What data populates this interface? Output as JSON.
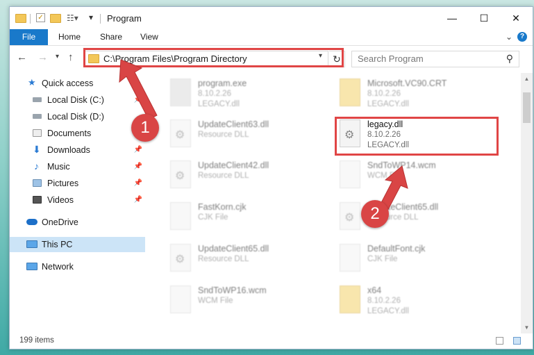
{
  "window": {
    "title": "Program"
  },
  "ribbon": {
    "file": "File",
    "home": "Home",
    "share": "Share",
    "view": "View"
  },
  "nav": {
    "address": "C:\\Program Files\\Program Directory",
    "search_placeholder": "Search Program"
  },
  "sidebar": {
    "items": [
      {
        "label": "Quick access",
        "icon": "star-icon",
        "pinned": false
      },
      {
        "label": "Local Disk (C:)",
        "icon": "drive-icon",
        "pinned": true
      },
      {
        "label": "Local Disk (D:)",
        "icon": "drive-icon",
        "pinned": false
      },
      {
        "label": "Documents",
        "icon": "documents-icon",
        "pinned": true
      },
      {
        "label": "Downloads",
        "icon": "download-icon",
        "pinned": true
      },
      {
        "label": "Music",
        "icon": "music-icon",
        "pinned": true
      },
      {
        "label": "Pictures",
        "icon": "pictures-icon",
        "pinned": true
      },
      {
        "label": "Videos",
        "icon": "videos-icon",
        "pinned": true
      },
      {
        "label": "OneDrive",
        "icon": "cloud-icon",
        "pinned": false
      },
      {
        "label": "This PC",
        "icon": "computer-icon",
        "pinned": false,
        "selected": true
      },
      {
        "label": "Network",
        "icon": "network-icon",
        "pinned": false
      }
    ]
  },
  "files": [
    {
      "name": "program.exe",
      "line2": "8.10.2.26",
      "line3": "LEGACY.dll",
      "icon": "exe"
    },
    {
      "name": "Microsoft.VC90.CRT",
      "line2": "8.10.2.26",
      "line3": "LEGACY.dll",
      "icon": "folder"
    },
    {
      "name": "UpdateClient63.dll",
      "line2": "Resource DLL",
      "line3": "",
      "icon": "gear"
    },
    {
      "name": "legacy.dll",
      "line2": "8.10.2.26",
      "line3": "LEGACY.dll",
      "icon": "gear"
    },
    {
      "name": "UpdateClient42.dll",
      "line2": "Resource DLL",
      "line3": "",
      "icon": "gear"
    },
    {
      "name": "SndToWP14.wcm",
      "line2": "WCM File",
      "line3": "",
      "icon": "doc"
    },
    {
      "name": "FastKorn.cjk",
      "line2": "CJK File",
      "line3": "",
      "icon": "doc"
    },
    {
      "name": "UpdateClient65.dll",
      "line2": "Resource DLL",
      "line3": "",
      "icon": "gear"
    },
    {
      "name": "UpdateClient65.dll",
      "line2": "Resource DLL",
      "line3": "",
      "icon": "gear"
    },
    {
      "name": "DefaultFont.cjk",
      "line2": "CJK File",
      "line3": "",
      "icon": "doc"
    },
    {
      "name": "SndToWP16.wcm",
      "line2": "WCM File",
      "line3": "",
      "icon": "doc"
    },
    {
      "name": "x64",
      "line2": "8.10.2.26",
      "line3": "LEGACY.dll",
      "icon": "folder"
    }
  ],
  "status": {
    "count": "199 items"
  },
  "annotations": {
    "step1": "1",
    "step2": "2"
  },
  "colors": {
    "accent": "#1979ca",
    "highlight": "#e04545",
    "selected": "#cce4f7"
  }
}
